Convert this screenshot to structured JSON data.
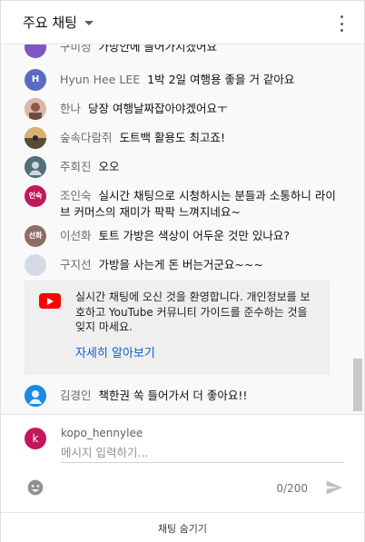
{
  "header": {
    "title": "주요 채팅"
  },
  "messages": [
    {
      "author": "구미정",
      "text": "가방안에 들어가지겠어요",
      "avatar_letter": "",
      "avatar_color": "#7e57c2"
    },
    {
      "author": "Hyun Hee LEE",
      "text": "1박 2일 여행용 좋을 거 같아요",
      "avatar_letter": "H",
      "avatar_color": "#5c6bc0"
    },
    {
      "author": "한나",
      "text": "당장 여행날짜잡아야겠어요ㅜ",
      "avatar_letter": "",
      "avatar_color": "#a1887f"
    },
    {
      "author": "숲속다람쥐",
      "text": "도트백 활용도 최고죠!",
      "avatar_letter": "",
      "avatar_color": "#8d6e63"
    },
    {
      "author": "주회진",
      "text": "오오",
      "avatar_letter": "",
      "avatar_color": "#546e7a"
    },
    {
      "author": "조인숙",
      "text": "실시간 채팅으로 시청하시는 분들과 소통하니 라이브 커머스의 재미가 팍팍 느껴지네요~",
      "avatar_letter": "인숙",
      "avatar_color": "#c2185b"
    },
    {
      "author": "이선화",
      "text": "토트 가방은 색상이 어두운 것만 있나요?",
      "avatar_letter": "선화",
      "avatar_color": "#8d6e63"
    },
    {
      "author": "구지선",
      "text": "가방을 사는게 돈 버는거군요~~~",
      "avatar_letter": "",
      "avatar_color": "#d5dbe6"
    },
    {
      "author": "김경인",
      "text": "책한권 쏙 들어가서 더 좋아요!!",
      "avatar_letter": "",
      "avatar_color": "#1e88e5"
    }
  ],
  "welcome": {
    "text": "실시간 채팅에 오신 것을 환영합니다. 개인정보를 보호하고 YouTube 커뮤니티 가이드를 준수하는 것을 잊지 마세요.",
    "link": "자세히 알아보기",
    "brand_color": "#ff0000",
    "link_color": "#065fd4"
  },
  "compose": {
    "user_initial": "k",
    "user_name": "kopo_hennylee",
    "placeholder": "메시지 입력하기...",
    "value": "",
    "counter": "0/200"
  },
  "footer": {
    "hide_chat": "채팅 숨기기"
  },
  "icons": {
    "header_menu": "more-vert-icon",
    "dropdown": "caret-down-icon",
    "emoji": "emoji-icon",
    "send": "send-icon",
    "welcome": "youtube-icon"
  }
}
